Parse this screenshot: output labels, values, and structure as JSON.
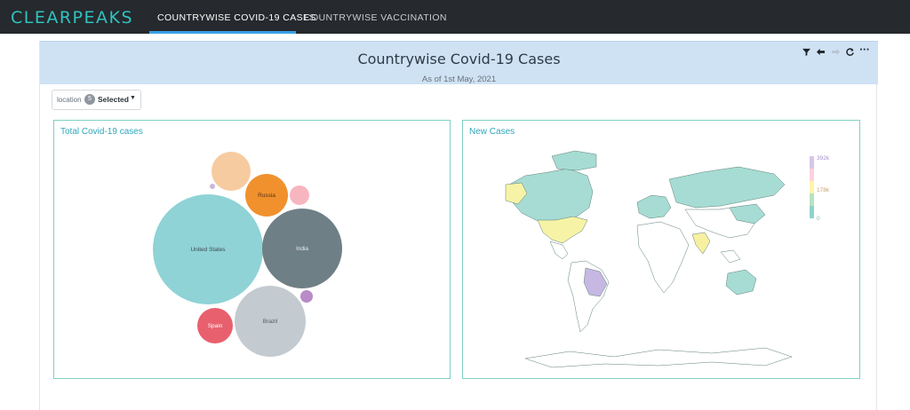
{
  "brand": {
    "name": "CLEARPEAKS"
  },
  "nav": {
    "tabs": [
      {
        "label": "COUNTRYWISE COVID-19 CASES",
        "active": true
      },
      {
        "label": "COUNTRYWISE VACCINATION",
        "active": false
      }
    ]
  },
  "dashboard": {
    "title": "Countrywise Covid-19 Cases",
    "subtitle": "As of 1st May, 2021",
    "toolbar": [
      "filter-icon",
      "back-arrow-icon",
      "forward-arrow-icon",
      "refresh-icon",
      "more-icon"
    ]
  },
  "filter": {
    "label": "location",
    "count": "5",
    "selected_text": "Selected"
  },
  "bubble_panel": {
    "title": "Total Covid-19 cases",
    "bubbles": [
      {
        "label": "United States",
        "color": "#8fd3d6"
      },
      {
        "label": "India",
        "color": "#6f7f86"
      },
      {
        "label": "Brazil",
        "color": "#c3cbd1"
      },
      {
        "label": "Russia",
        "color": "#f0912e"
      },
      {
        "label": "Spain",
        "color": "#e8606e"
      },
      {
        "label": "",
        "color": "#f7cba0"
      },
      {
        "label": "",
        "color": "#f7b5c0"
      },
      {
        "label": "",
        "color": "#b98bc7"
      },
      {
        "label": "",
        "color": "#c9b9d6"
      }
    ]
  },
  "map_panel": {
    "title": "New Cases",
    "legend": {
      "labels": [
        "392k",
        "178k",
        "0"
      ],
      "colors": [
        "#d6c7e6",
        "#ffd1dc",
        "#fff5a8",
        "#b7e3c0",
        "#8fd3c9"
      ]
    },
    "highlighted": {
      "united_states": "#f7f3a6",
      "brazil": "#c6b8e3",
      "india": "#f7f0a0",
      "default_fill": "#a6dcd3"
    }
  }
}
